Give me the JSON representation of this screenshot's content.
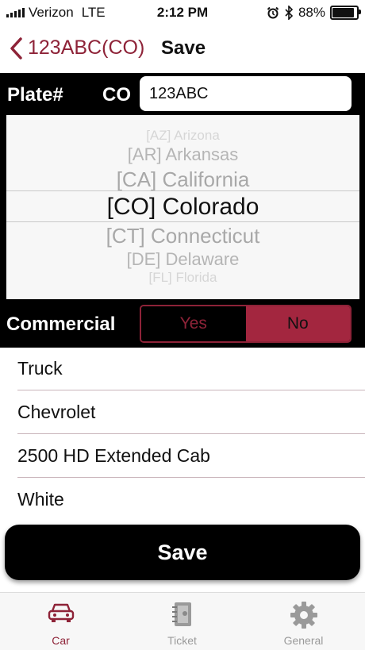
{
  "status_bar": {
    "carrier": "Verizon",
    "network": "LTE",
    "time": "2:12 PM",
    "battery": "88%"
  },
  "nav": {
    "back_label": "123ABC(CO)",
    "save_label": "Save"
  },
  "plate": {
    "label": "Plate#",
    "state": "CO",
    "value": "123ABC"
  },
  "state_picker": {
    "items": [
      "[AZ] Arizona",
      "[AR] Arkansas",
      "[CA] California",
      "[CO] Colorado",
      "[CT] Connecticut",
      "[DE] Delaware",
      "[FL] Florida"
    ],
    "selected": "[CO] Colorado"
  },
  "commercial": {
    "label": "Commercial",
    "yes": "Yes",
    "no": "No",
    "selected": "No"
  },
  "vehicle": {
    "type": "Truck",
    "make": "Chevrolet",
    "model": "2500 HD Extended Cab",
    "color": "White"
  },
  "save_button": "Save",
  "tabs": [
    {
      "label": "Car",
      "icon": "car-icon",
      "active": true
    },
    {
      "label": "Ticket",
      "icon": "notebook-icon",
      "active": false
    },
    {
      "label": "General",
      "icon": "gear-icon",
      "active": false
    }
  ],
  "colors": {
    "accent": "#8e2338",
    "segment_selected": "#a3263f",
    "panel": "#000000",
    "tab_inactive": "#9a9a9a"
  }
}
